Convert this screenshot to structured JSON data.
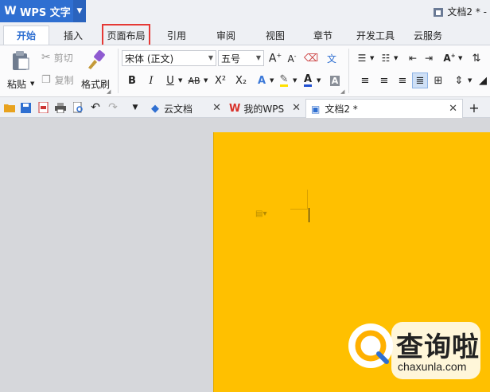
{
  "app": {
    "title": "WPS 文字",
    "logo": "W",
    "document_title": "文档2 * -"
  },
  "ribbon_tabs": [
    {
      "label": "开始",
      "active": true
    },
    {
      "label": "插入"
    },
    {
      "label": "页面布局",
      "highlighted": true
    },
    {
      "label": "引用"
    },
    {
      "label": "审阅"
    },
    {
      "label": "视图"
    },
    {
      "label": "章节"
    },
    {
      "label": "开发工具"
    },
    {
      "label": "云服务"
    }
  ],
  "clipboard": {
    "paste": "粘贴",
    "cut": "剪切",
    "copy": "复制",
    "format_painter": "格式刷"
  },
  "font": {
    "name": "宋体 (正文)",
    "size": "五号",
    "bold": "B",
    "italic": "I",
    "underline": "U",
    "strike": "AB",
    "superscript": "X²",
    "subscript": "X₂"
  },
  "doc_tabs": [
    {
      "label": "云文档"
    },
    {
      "label": "我的WPS"
    },
    {
      "label": "文档2 *",
      "active": true
    }
  ],
  "watermark": {
    "name": "查询啦",
    "url": "chaxunla.com"
  },
  "colors": {
    "accent": "#2f6fd1",
    "page": "#ffc000",
    "highlight_box": "#e53935"
  }
}
